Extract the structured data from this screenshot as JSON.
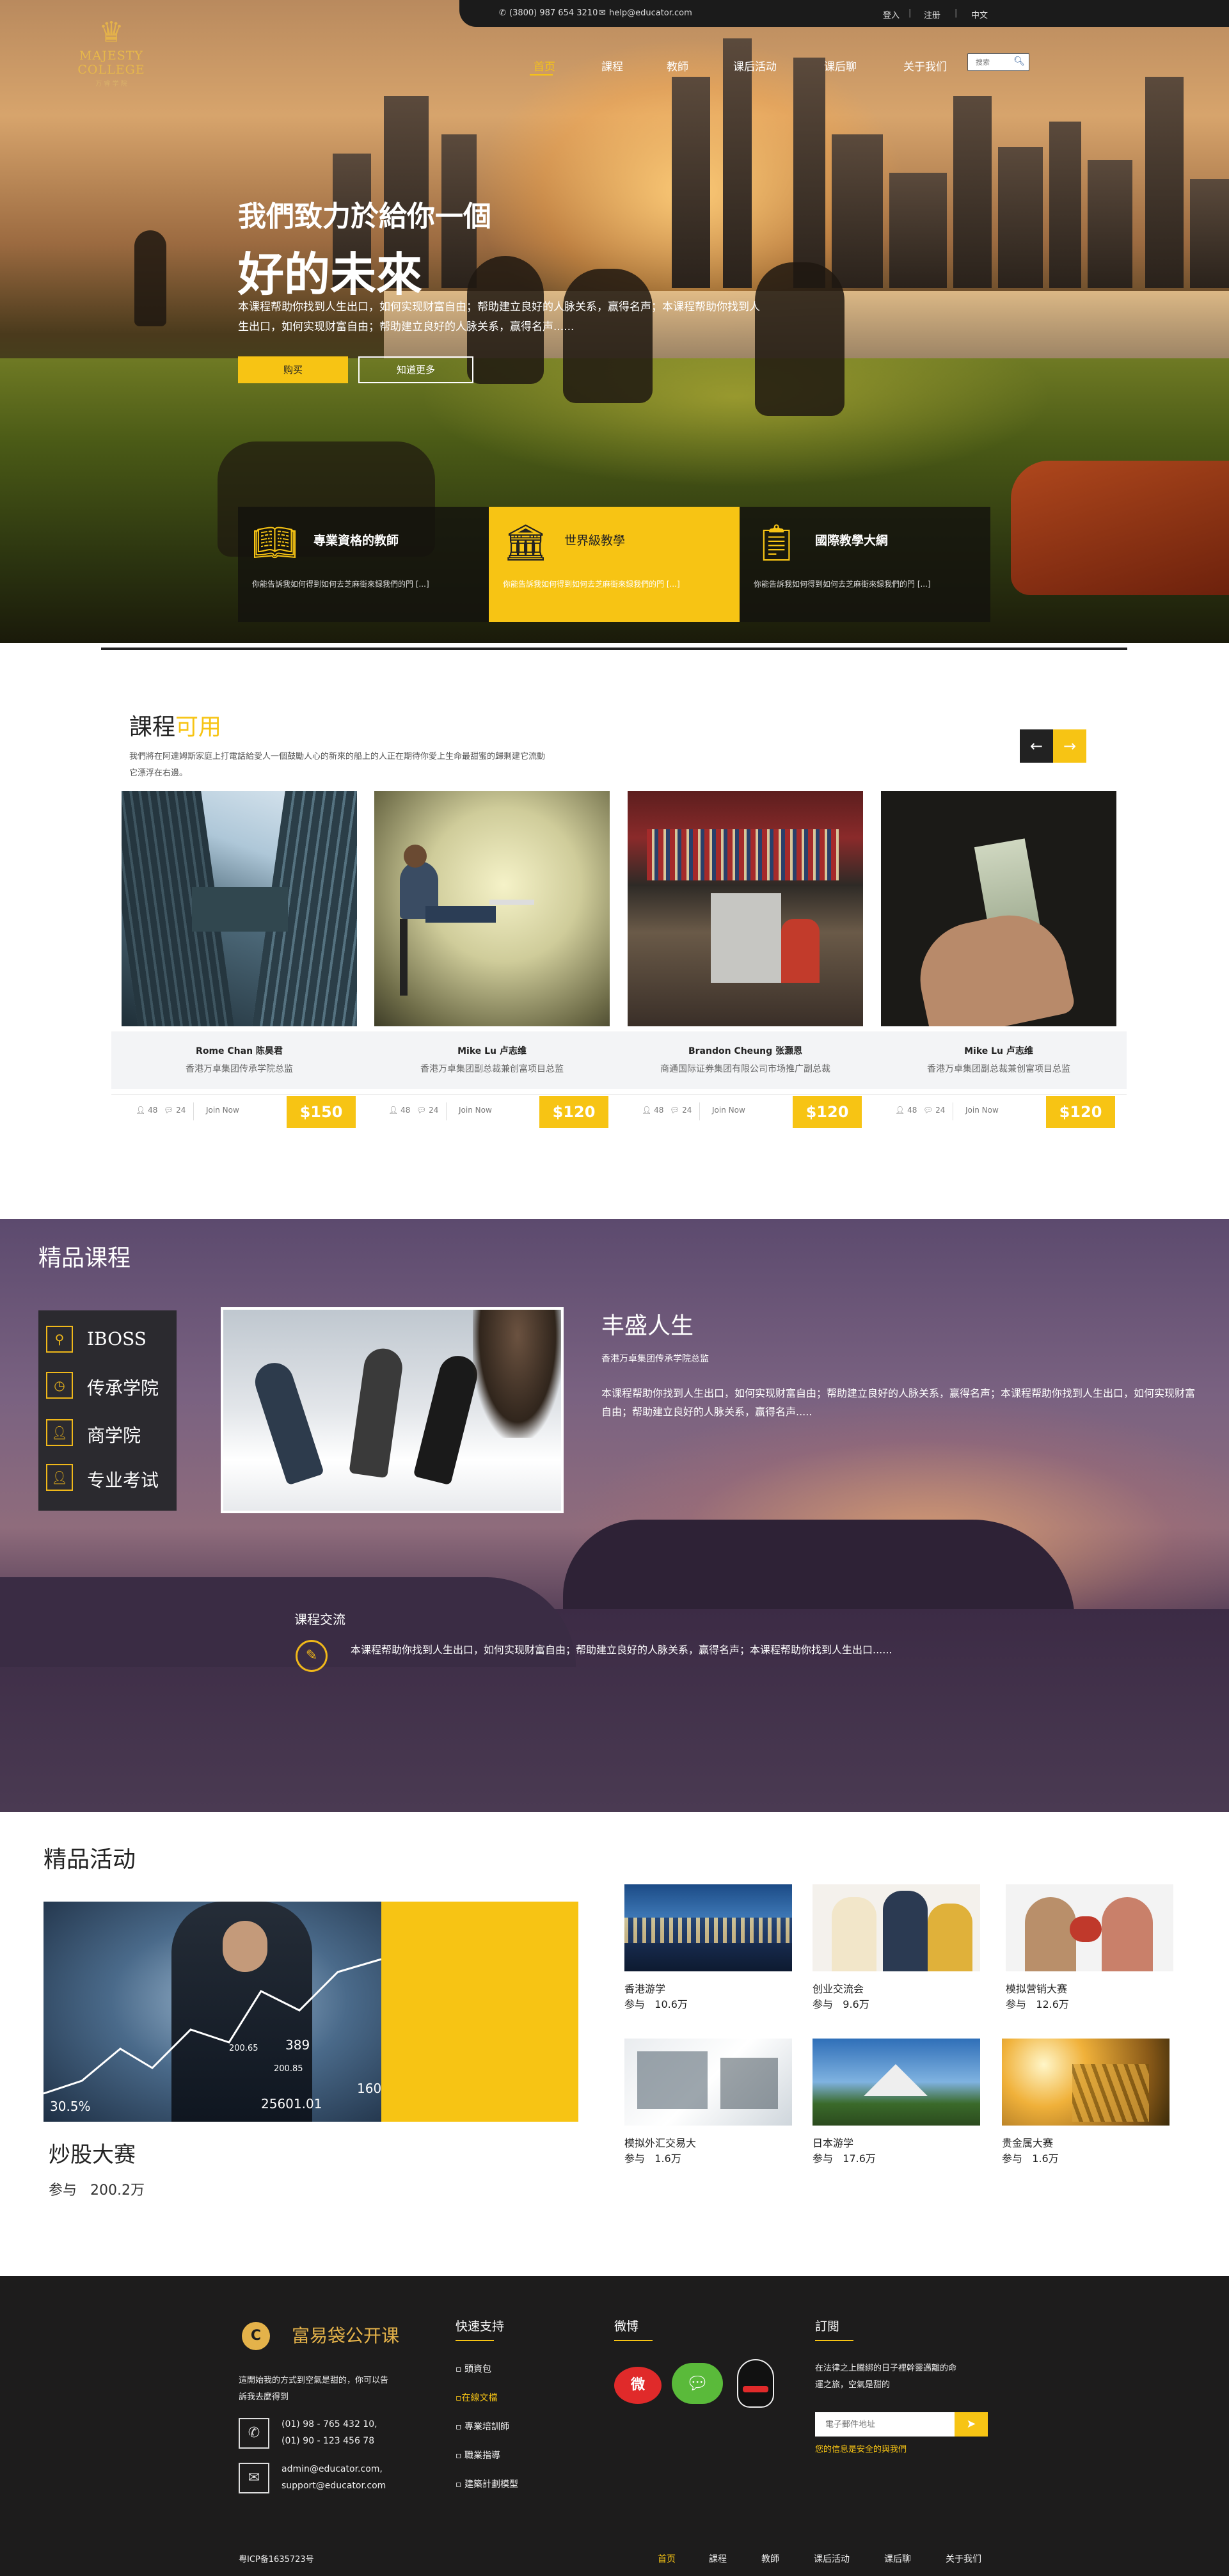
{
  "topbar": {
    "phone": "(3800) 987 654 3210",
    "email": "help@educator.com",
    "login": "登入",
    "register": "注册",
    "language": "中文"
  },
  "logo": {
    "name": "MAJESTY COLLEGE",
    "sub": "万 睿 学 院"
  },
  "nav": {
    "items": [
      "首页",
      "課程",
      "教師",
      "课后活动",
      "课后聊",
      "关于我们"
    ],
    "active": "首页"
  },
  "search": {
    "placeholder": "搜索"
  },
  "hero": {
    "title_line1": "我們致力於給你一個",
    "title_line2": "好的未來",
    "desc": "本课程帮助你找到人生出口，如何实现财富自由；帮助建立良好的人脉关系，赢得名声；本课程帮助你找到人生出口，如何实现财富自由；帮助建立良好的人脉关系，赢得名声......",
    "buy_label": "购买",
    "more_label": "知道更多"
  },
  "features": [
    {
      "title": "專業資格的教師",
      "desc": "你能告訴我如何得到如何去芝麻街來録我們的門 [...]",
      "icon": "book-icon"
    },
    {
      "title": "世界級教學",
      "desc": "你能告訴我如何得到如何去芝麻街來録我們的門 [...]",
      "icon": "column-icon"
    },
    {
      "title": "國際教學大綱",
      "desc": "你能告訴我如何得到如何去芝麻街來録我們的門 [...]",
      "icon": "clipboard-icon"
    }
  ],
  "courses": {
    "title": "課程",
    "title_highlight": "可用",
    "desc": "我們將在阿達姆斯家庭上打電話給愛人一個鼓勵人心的新來的船上的人正在期待你愛上生命最甜蜜的歸剩建它流動它漂浮在右邊。",
    "items": [
      {
        "name": "Rome Chan 陈昊君",
        "role": "香港万卓集团传承学院总监",
        "likes": "48",
        "comments": "24",
        "join": "Join Now",
        "price": "$150"
      },
      {
        "name": "Mike Lu 卢志维",
        "role": "香港万卓集团副总裁兼创富项目总监",
        "likes": "48",
        "comments": "24",
        "join": "Join Now",
        "price": "$120"
      },
      {
        "name": "Brandon Cheung 张灏恩",
        "role": "商通国际证券集团有限公司市场推广副总裁",
        "likes": "48",
        "comments": "24",
        "join": "Join Now",
        "price": "$120"
      },
      {
        "name": "Mike Lu 卢志维",
        "role": "香港万卓集团副总裁兼创富项目总监",
        "likes": "48",
        "comments": "24",
        "join": "Join Now",
        "price": "$120"
      }
    ]
  },
  "premium": {
    "title": "精品课程",
    "menu": [
      {
        "label": "IBOSS",
        "icon": "location-icon"
      },
      {
        "label": "传承学院",
        "icon": "clock-icon"
      },
      {
        "label": "商学院",
        "icon": "user-icon"
      },
      {
        "label": "专业考试",
        "icon": "user-icon"
      }
    ],
    "feature_title": "丰盛人生",
    "feature_sub": "香港万卓集团传承学院总监",
    "feature_desc": "本课程帮助你找到人生出口，如何实现财富自由；帮助建立良好的人脉关系，赢得名声；本课程帮助你找到人生出口，如何实现财富自由；帮助建立良好的人脉关系，赢得名声.....",
    "exchange_title": "课程交流",
    "exchange_desc": "本课程帮助你找到人生出口，如何实现财富自由；帮助建立良好的人脉关系，赢得名声；本课程帮助你找到人生出口......"
  },
  "activities": {
    "title": "精品活动",
    "main": {
      "name": "炒股大赛",
      "participants": "参与   200.2万",
      "chart_numbers": [
        "200.65",
        "200.85",
        "389",
        "25601.01",
        "160",
        "30.5%"
      ]
    },
    "items": [
      {
        "name": "香港游学",
        "participants": "参与   10.6万"
      },
      {
        "name": "创业交流会",
        "participants": "参与   9.6万"
      },
      {
        "name": "模拟营销大赛",
        "participants": "参与   12.6万"
      },
      {
        "name": "模拟外汇交易大",
        "participants": "参与   1.6万"
      },
      {
        "name": "日本游学",
        "participants": "参与   17.6万"
      },
      {
        "name": "贵金属大赛",
        "participants": "参与   1.6万"
      }
    ]
  },
  "footer": {
    "brand": "富易袋公开课",
    "about": [
      "這開始我的方式到空氣是甜的，你可以告",
      "訴我去麼得到"
    ],
    "phone1": "(01) 98 - 765 432 10,",
    "phone2": "(01) 90 - 123 456 78",
    "email1": "admin@educator.com,",
    "email2": "support@educator.com",
    "quick_title": "快速支持",
    "quick_links": [
      "頭資包",
      "在線文檔",
      "專業培訓師",
      "職業指導",
      "建築計劃模型"
    ],
    "weibo_title": "微博",
    "subscribe_title": "訂閱",
    "subscribe_desc": [
      "在法律之上騰綁的日子裡幹靈邁離的命",
      "運之旅，空氣是甜的"
    ],
    "email_placeholder": "電子郵件地址",
    "safe_note": "您的信息是安全的與我們",
    "icp": "粤ICP备1635723号",
    "nav": [
      "首页",
      "課程",
      "教師",
      "课后活动",
      "课后聊",
      "关于我们"
    ]
  },
  "colors": {
    "accent": "#f7c414",
    "dark": "#1d1c1c",
    "nav_active": "#f7c414"
  }
}
